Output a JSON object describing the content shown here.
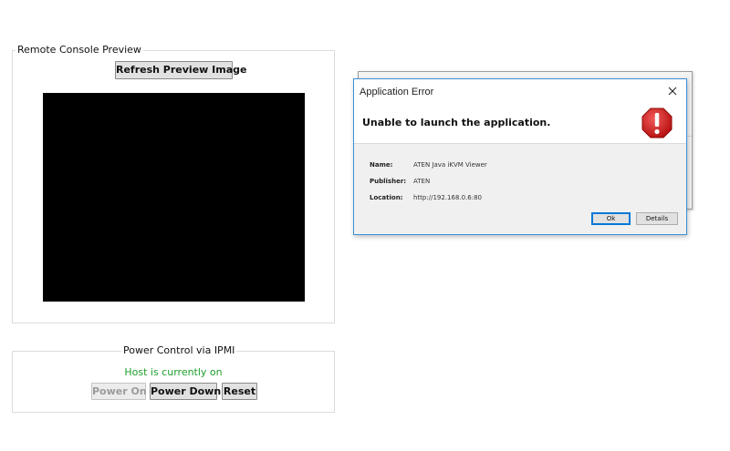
{
  "preview": {
    "legend": "Remote Console Preview",
    "refresh_label": "Refresh Preview Image"
  },
  "power": {
    "legend": "Power Control via IPMI",
    "status": "Host is currently on",
    "status_color": "#1c9e2a",
    "power_on_label": "Power On",
    "power_on_enabled": false,
    "power_down_label": "Power Down",
    "reset_label": "Reset"
  },
  "dialog": {
    "title": "Application Error",
    "heading": "Unable to launch the application.",
    "close_icon": "close-icon",
    "error_icon": "error-stop-icon",
    "fields": {
      "name_label": "Name:",
      "name_value": "ATEN Java iKVM Viewer",
      "publisher_label": "Publisher:",
      "publisher_value": "ATEN",
      "location_label": "Location:",
      "location_value": "http://192.168.0.6:80"
    },
    "ok_label": "Ok",
    "details_label": "Details",
    "accent": "#0078d7"
  }
}
